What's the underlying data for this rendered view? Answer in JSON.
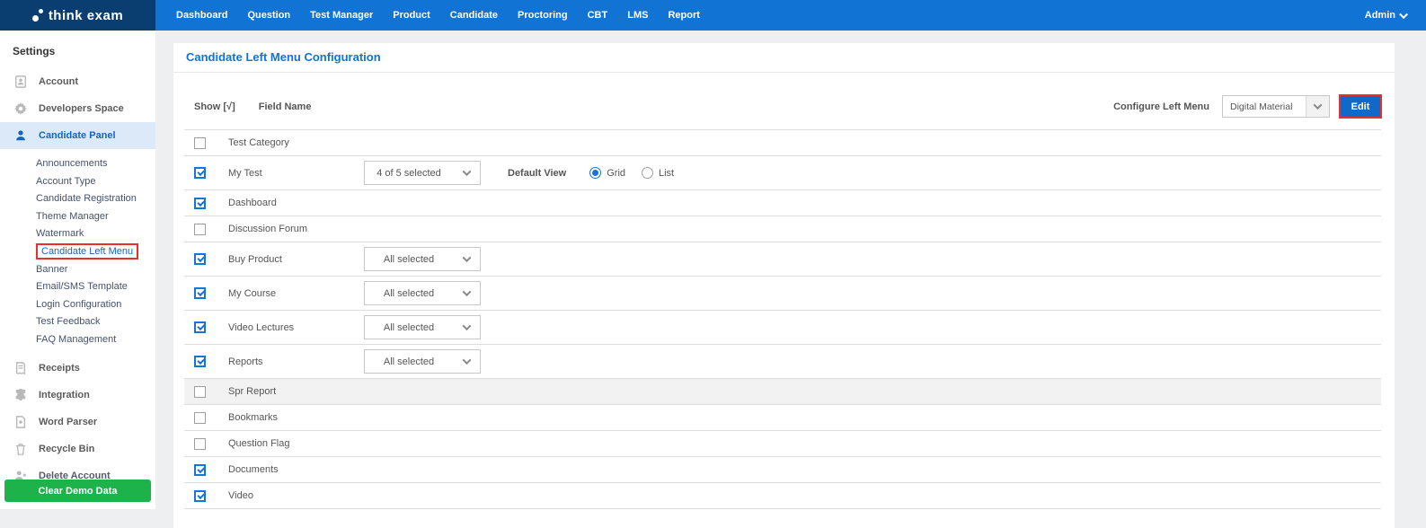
{
  "navbar": {
    "logo_text": "think exam",
    "items": [
      "Dashboard",
      "Question",
      "Test Manager",
      "Product",
      "Candidate",
      "Proctoring",
      "CBT",
      "LMS",
      "Report"
    ],
    "admin_label": "Admin"
  },
  "sidebar": {
    "title": "Settings",
    "top_items": [
      {
        "label": "Account",
        "icon": "account-icon",
        "active": false
      },
      {
        "label": "Developers Space",
        "icon": "gear-icon",
        "active": false
      },
      {
        "label": "Candidate Panel",
        "icon": "person-icon",
        "active": true
      }
    ],
    "candidate_panel_subitems": [
      {
        "label": "Announcements",
        "selected": false
      },
      {
        "label": "Account Type",
        "selected": false
      },
      {
        "label": "Candidate Registration",
        "selected": false
      },
      {
        "label": "Theme Manager",
        "selected": false
      },
      {
        "label": "Watermark",
        "selected": false
      },
      {
        "label": "Candidate Left Menu",
        "selected": true
      },
      {
        "label": "Banner",
        "selected": false
      },
      {
        "label": "Email/SMS Template",
        "selected": false
      },
      {
        "label": "Login Configuration",
        "selected": false
      },
      {
        "label": "Test Feedback",
        "selected": false
      },
      {
        "label": "FAQ Management",
        "selected": false
      }
    ],
    "bottom_items": [
      {
        "label": "Receipts",
        "icon": "receipt-icon"
      },
      {
        "label": "Integration",
        "icon": "puzzle-icon"
      },
      {
        "label": "Word Parser",
        "icon": "document-icon"
      },
      {
        "label": "Recycle Bin",
        "icon": "trash-icon"
      },
      {
        "label": "Delete Account",
        "icon": "person-remove-icon"
      }
    ],
    "clear_demo_button": "Clear Demo Data"
  },
  "main": {
    "title": "Candidate Left Menu Configuration",
    "show_header": "Show [√]",
    "field_name_header": "Field Name",
    "configure_label": "Configure Left Menu",
    "configure_value": "Digital Material",
    "edit_button": "Edit",
    "default_view_label": "Default View",
    "rows": [
      {
        "field": "Test Category",
        "checked": false
      },
      {
        "field": "My Test",
        "checked": true,
        "dropdown": "4 of 5 selected",
        "default_view": {
          "options": [
            "Grid",
            "List"
          ],
          "selected": "Grid"
        }
      },
      {
        "field": "Dashboard",
        "checked": true
      },
      {
        "field": "Discussion Forum",
        "checked": false
      },
      {
        "field": "Buy Product",
        "checked": true,
        "dropdown": "All selected"
      },
      {
        "field": "My Course",
        "checked": true,
        "dropdown": "All selected"
      },
      {
        "field": "Video Lectures",
        "checked": true,
        "dropdown": "All selected"
      },
      {
        "field": "Reports",
        "checked": true,
        "dropdown": "All selected"
      },
      {
        "field": "Spr Report",
        "checked": false,
        "highlighted": true
      },
      {
        "field": "Bookmarks",
        "checked": false
      },
      {
        "field": "Question Flag",
        "checked": false
      },
      {
        "field": "Documents",
        "checked": true
      },
      {
        "field": "Video",
        "checked": true
      }
    ]
  },
  "colors": {
    "navbar_blue": "#1173d4",
    "logo_dark_blue": "#0a3d70",
    "active_item_bg": "#dce9f8",
    "link_blue": "#1565c0",
    "highlight_red": "#e5302c",
    "green_button": "#1db24a",
    "checkbox_blue": "#1a73d6"
  }
}
